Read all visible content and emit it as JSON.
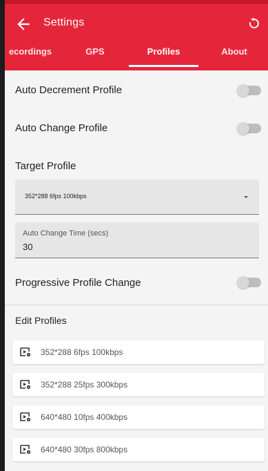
{
  "app_bar": {
    "title": "Settings",
    "back_icon": "arrow-left-icon",
    "reset_icon": "refresh-icon",
    "background": "#e5263a"
  },
  "tabs": [
    {
      "label": "ecordings",
      "active": false
    },
    {
      "label": "GPS",
      "active": false
    },
    {
      "label": "Profiles",
      "active": true
    },
    {
      "label": "About",
      "active": false
    }
  ],
  "settings": {
    "auto_decrement": {
      "label": "Auto Decrement Profile",
      "enabled": false
    },
    "auto_change": {
      "label": "Auto Change Profile",
      "enabled": false
    },
    "target_profile": {
      "heading": "Target Profile",
      "selected": "352*288 6fps 100kbps"
    },
    "auto_change_time": {
      "label": "Auto Change Time (secs)",
      "value": "30"
    },
    "progressive": {
      "label": "Progressive Profile Change",
      "enabled": false
    }
  },
  "edit_profiles": {
    "heading": "Edit Profiles",
    "icon": "video-settings-icon",
    "items": [
      {
        "label": "352*288 6fps 100kbps"
      },
      {
        "label": "352*288 25fps 300kbps"
      },
      {
        "label": "640*480 10fps 400kbps"
      },
      {
        "label": "640*480 30fps 800kbps"
      }
    ]
  }
}
